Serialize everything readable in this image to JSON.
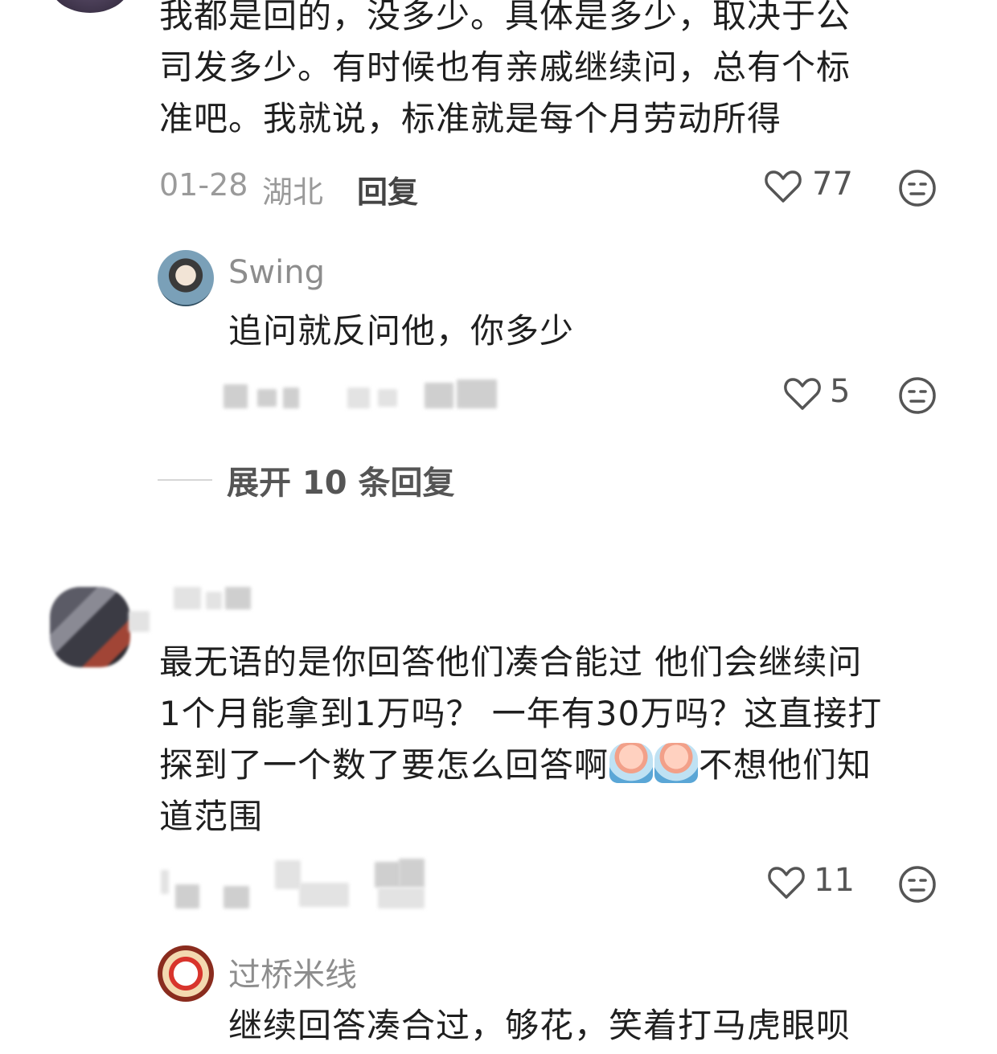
{
  "comments": [
    {
      "text_lines": [
        "我都是回的，没多少。具体是多少，取决于公",
        "司发多少。有时候也有亲戚继续问，总有个标",
        "准吧。我就说，标准就是每个月劳动所得"
      ],
      "date": "01-28",
      "location": "湖北",
      "reply_label": "回复",
      "likes": "77",
      "replies": [
        {
          "username": "Swing",
          "text": "追问就反问他，你多少",
          "likes": "5"
        }
      ],
      "expand_label": "展开 10 条回复"
    },
    {
      "text_lines": [
        "最无语的是你回答他们凑合能过 他们会继续问",
        "1个月能拿到1万吗？ 一年有30万吗？这直接打",
        "探到了一个数了要怎么回答啊",
        "不想他们知",
        "道范围"
      ],
      "likes": "11",
      "replies": [
        {
          "username": "过桥米线",
          "text": "继续回答凑合过，够花，笑着打马虎眼呗"
        }
      ]
    }
  ],
  "icons": {
    "like": "heart-outline-icon",
    "dislike": "neutral-face-icon"
  },
  "colors": {
    "text": "#1f1f1f",
    "meta": "#9a9a9a",
    "username": "#8d8d8d"
  }
}
